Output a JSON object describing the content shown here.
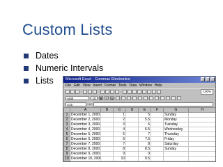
{
  "slide": {
    "title": "Custom Lists",
    "bullets": [
      "Dates",
      "Numeric Intervals",
      "Lists"
    ],
    "colors": {
      "title": "#1f4d8f",
      "bullet": "#233a78"
    }
  },
  "excel": {
    "window_title": "Microsoft Excel - Commas Electronics",
    "menu": [
      "File",
      "Edit",
      "View",
      "Insert",
      "Format",
      "Tools",
      "Data",
      "Window",
      "Help"
    ],
    "zoom": "100%",
    "font": "Arial",
    "font_size": "10",
    "format_buttons": [
      "B",
      "I",
      "U"
    ],
    "name_box": "A15",
    "formula_symbol": "=",
    "columns": [
      "A",
      "B",
      "C",
      "D",
      "E",
      "F",
      "G",
      "H"
    ],
    "rows": [
      {
        "n": "1",
        "cells": [
          "December 1, 2000",
          "",
          "1",
          "",
          "5",
          "",
          "Sunday",
          ""
        ]
      },
      {
        "n": "2",
        "cells": [
          "December 2, 2000",
          "",
          "2",
          "",
          "5.5",
          "",
          "Monday",
          ""
        ]
      },
      {
        "n": "3",
        "cells": [
          "December 3, 2000",
          "",
          "3",
          "",
          "6",
          "",
          "Tuesday",
          ""
        ]
      },
      {
        "n": "4",
        "cells": [
          "December 4, 2000",
          "",
          "4",
          "",
          "6.5",
          "",
          "Wednesday",
          ""
        ]
      },
      {
        "n": "5",
        "cells": [
          "December 5, 2000",
          "",
          "5",
          "",
          "7",
          "",
          "Thursday",
          ""
        ]
      },
      {
        "n": "6",
        "cells": [
          "December 6, 2000",
          "",
          "6",
          "",
          "7.5",
          "",
          "Friday",
          ""
        ]
      },
      {
        "n": "7",
        "cells": [
          "December 7, 2000",
          "",
          "7",
          "",
          "8",
          "",
          "Saturday",
          ""
        ]
      },
      {
        "n": "8",
        "cells": [
          "December 8, 2000",
          "",
          "8",
          "",
          "8.5",
          "",
          "Sunday",
          ""
        ]
      },
      {
        "n": "9",
        "cells": [
          "December 9, 2000",
          "",
          "9",
          "",
          "9",
          "",
          "",
          ""
        ]
      },
      {
        "n": "10",
        "cells": [
          "December 10, 2000",
          "",
          "10",
          "",
          "9.5",
          "",
          "",
          ""
        ]
      },
      {
        "n": "11",
        "cells": [
          "",
          "",
          "",
          "",
          "",
          "",
          "",
          ""
        ]
      },
      {
        "n": "12",
        "cells": [
          "",
          "",
          "",
          "",
          "",
          "",
          "",
          ""
        ]
      }
    ]
  }
}
